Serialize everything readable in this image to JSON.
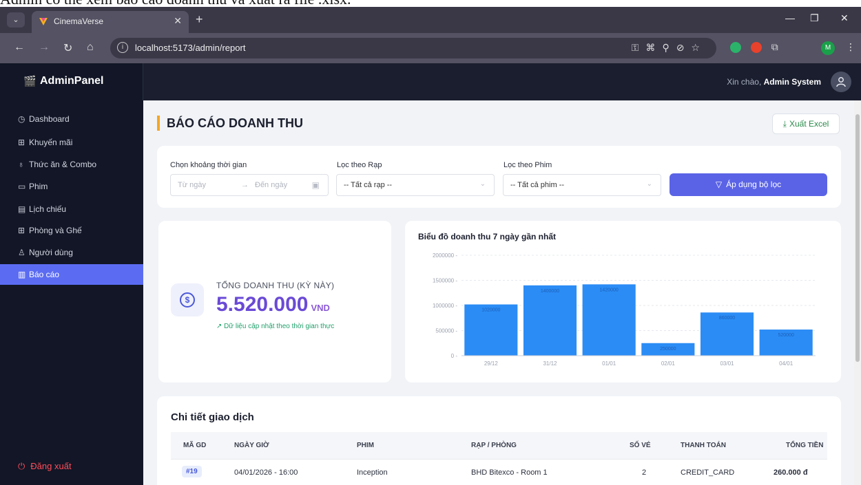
{
  "caption": "Admin có thể xem báo cáo doanh thu và xuất ra file .xlsx.",
  "browser": {
    "tab_title": "CinemaVerse",
    "url": "localhost:5173/admin/report"
  },
  "app": {
    "brand": "AdminPanel",
    "greeting_prefix": "Xin chào,",
    "user_name": "Admin System"
  },
  "sidebar": {
    "items": [
      {
        "label": "Dashboard",
        "icon": "dashboard-icon"
      },
      {
        "label": "Khuyến mãi",
        "icon": "gift-icon"
      },
      {
        "label": "Thức ăn & Combo",
        "icon": "food-icon"
      },
      {
        "label": "Phim",
        "icon": "film-icon"
      },
      {
        "label": "Lịch chiếu",
        "icon": "calendar-icon"
      },
      {
        "label": "Phòng và Ghế",
        "icon": "grid-icon"
      },
      {
        "label": "Người dùng",
        "icon": "user-icon"
      },
      {
        "label": "Báo cáo",
        "icon": "chart-icon"
      }
    ],
    "active_index": 7,
    "logout_label": "Đăng xuất"
  },
  "page": {
    "title": "BÁO CÁO DOANH THU",
    "export_label": "Xuất Excel"
  },
  "filters": {
    "date_label": "Chọn khoảng thời gian",
    "from_placeholder": "Từ ngày",
    "to_placeholder": "Đến ngày",
    "cinema_label": "Lọc theo Rạp",
    "cinema_value": "-- Tất cả rạp --",
    "movie_label": "Lọc theo Phim",
    "movie_value": "-- Tất cả phim --",
    "apply_label": "Áp dụng bộ lọc"
  },
  "summary": {
    "label": "TỔNG DOANH THU (KỲ NÀY)",
    "value": "5.520.000",
    "unit": "VND",
    "note": "Dữ liệu cập nhật theo thời gian thực"
  },
  "chart_data": {
    "type": "bar",
    "title": "Biểu đồ doanh thu 7 ngày gần nhất",
    "categories": [
      "29/12",
      "31/12",
      "01/01",
      "02/01",
      "03/01",
      "04/01"
    ],
    "values": [
      1020000,
      1400000,
      1420000,
      250000,
      860000,
      520000
    ],
    "y_ticks": [
      "0",
      "500000",
      "1000000",
      "1500000",
      "2000000"
    ],
    "ylim": [
      0,
      2000000
    ],
    "bar_color": "#2b8cf5",
    "grid": true
  },
  "transactions": {
    "title": "Chi tiết giao dịch",
    "columns": [
      "MÃ GD",
      "NGÀY GIỜ",
      "PHIM",
      "RẠP / PHÒNG",
      "SỐ VÉ",
      "THANH TOÁN",
      "TỔNG TIỀN"
    ],
    "rows": [
      {
        "id": "#19",
        "datetime": "04/01/2026 - 16:00",
        "movie": "Inception",
        "room": "BHD Bitexco - Room 1",
        "tickets": "2",
        "payment": "CREDIT_CARD",
        "total": "260.000 đ"
      }
    ]
  }
}
